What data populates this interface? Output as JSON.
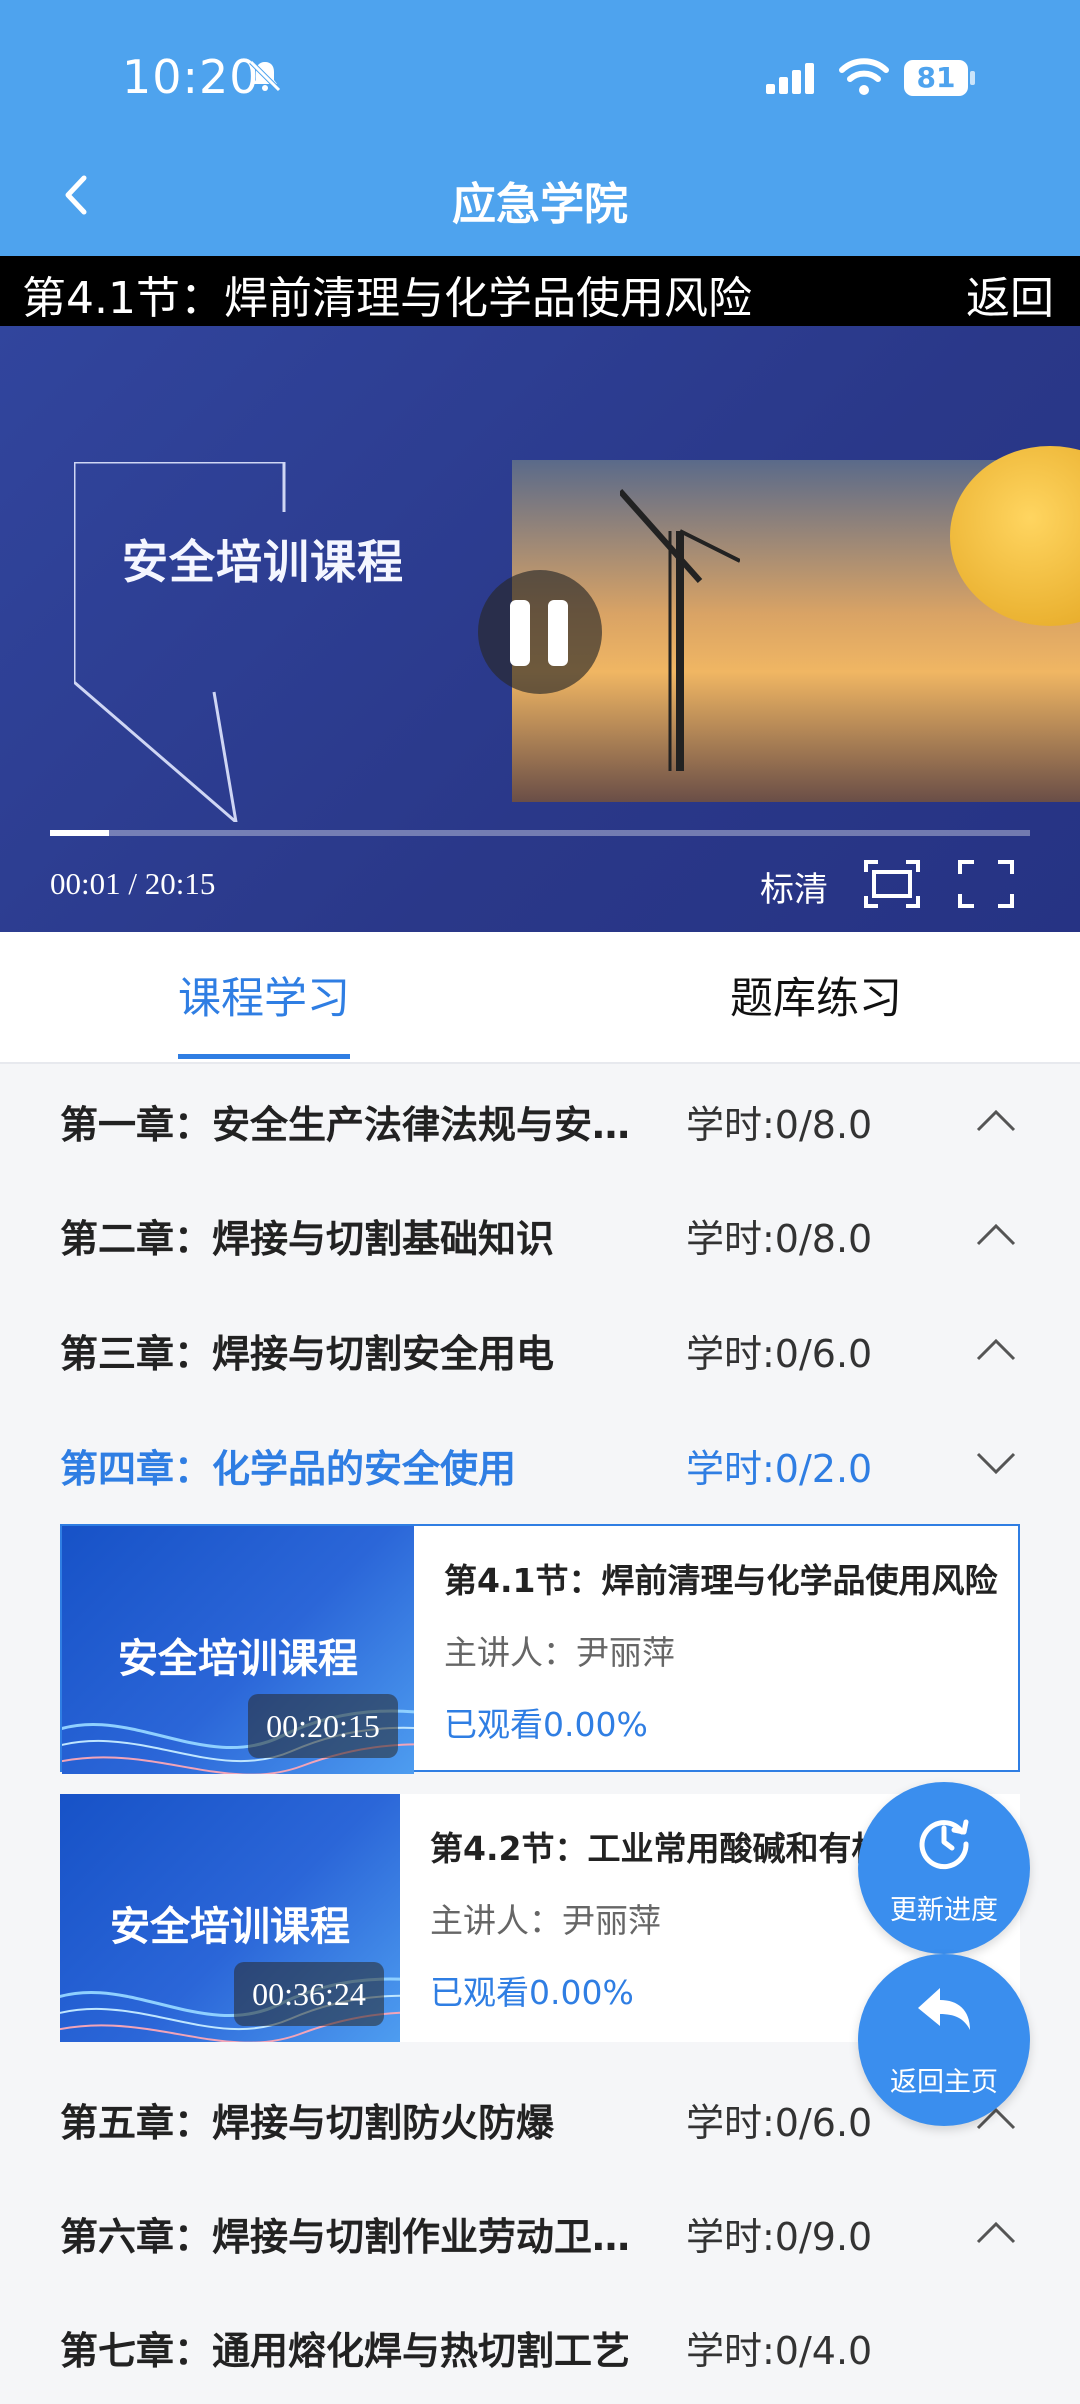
{
  "status_bar": {
    "time": "10:20",
    "battery": "81"
  },
  "nav": {
    "title": "应急学院"
  },
  "video": {
    "title": "第4.1节：焊前清理与化学品使用风险",
    "return_label": "返回",
    "brand_text": "安全培训课程",
    "time": "00:01 / 20:15",
    "progress_fraction": 0.06,
    "quality": "标清"
  },
  "tabs": [
    {
      "label": "课程学习"
    },
    {
      "label": "题库练习"
    }
  ],
  "chapters": [
    {
      "name": "第一章：安全生产法律法规与安…",
      "hours": "学时:0/8.0"
    },
    {
      "name": "第二章：焊接与切割基础知识",
      "hours": "学时:0/8.0"
    },
    {
      "name": "第三章：焊接与切割安全用电",
      "hours": "学时:0/6.0"
    },
    {
      "name": "第四章：化学品的安全使用",
      "hours": "学时:0/2.0"
    },
    {
      "name": "第五章：焊接与切割防火防爆",
      "hours": "学时:0/6.0"
    },
    {
      "name": "第六章：焊接与切割作业劳动卫…",
      "hours": "学时:0/9.0"
    },
    {
      "name": "第七章：通用熔化焊与热切割工艺",
      "hours": "学时:0/4.0"
    }
  ],
  "lessons": [
    {
      "thumb_text": "安全培训课程",
      "duration": "00:20:15",
      "title": "第4.1节：焊前清理与化学品使用风险",
      "lecturer": "主讲人：尹丽萍",
      "progress": "已观看0.00%"
    },
    {
      "thumb_text": "安全培训课程",
      "duration": "00:36:24",
      "title": "第4.2节：工业常用酸碱和有机",
      "lecturer": "主讲人：尹丽萍",
      "progress": "已观看0.00%"
    }
  ],
  "fabs": {
    "update": "更新进度",
    "home": "返回主页"
  }
}
